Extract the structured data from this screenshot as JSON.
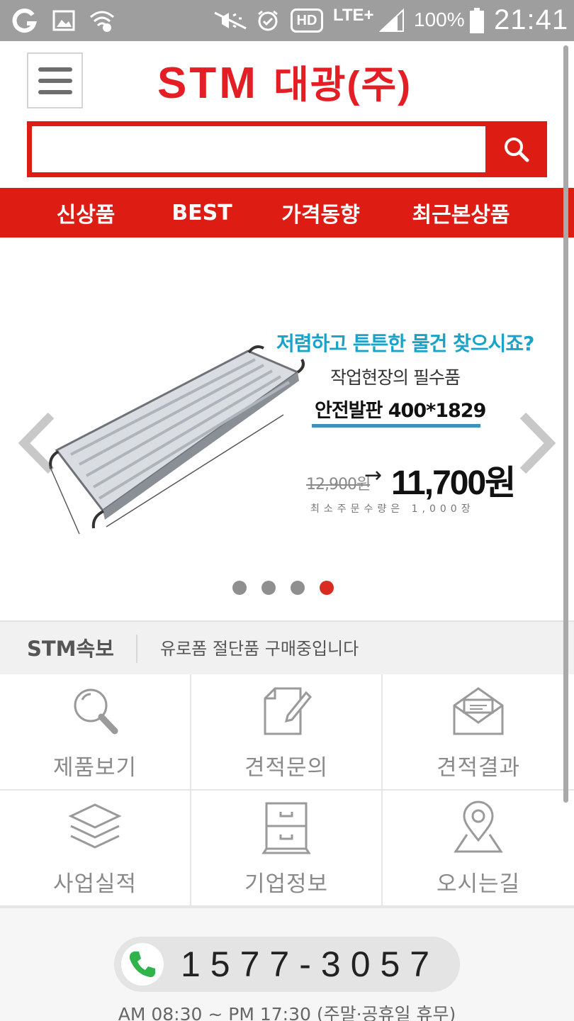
{
  "status_bar": {
    "battery": "100%",
    "time": "21:41",
    "network": "LTE+",
    "hd": "HD"
  },
  "header": {
    "logo": "STM",
    "logo_kor": "대광(주)",
    "search": {
      "placeholder": ""
    }
  },
  "nav": {
    "items": [
      "신상품",
      "BEST",
      "가격동향",
      "최근본상품"
    ]
  },
  "banner": {
    "headline": "저렴하고 튼튼한 물건 찾으시죠?",
    "sub": "작업현장의 필수품",
    "product": "안전발판 400*1829",
    "old_price": "12,900원",
    "arrow": "→",
    "new_price": "11,700원",
    "min_order": "최소주문수량은 1,000장",
    "slides_total": 4,
    "active_slide": 4,
    "accent": "#1aa3c9"
  },
  "news": {
    "title": "STM속보",
    "text": "유로폼 절단품 구매중입니다"
  },
  "menu_grid": [
    {
      "label": "제품보기",
      "icon": "search-icon"
    },
    {
      "label": "견적문의",
      "icon": "document-edit-icon"
    },
    {
      "label": "견적결과",
      "icon": "envelope-open-icon"
    },
    {
      "label": "사업실적",
      "icon": "layers-icon"
    },
    {
      "label": "기업정보",
      "icon": "cabinet-icon"
    },
    {
      "label": "오시는길",
      "icon": "map-pin-icon"
    }
  ],
  "footer": {
    "phone": "1577-3057",
    "hours": "AM 08:30 ~ PM 17:30 (주말·공휴일 휴무)"
  },
  "colors": {
    "brand_red": "#dd1c14",
    "status_bar": "#9e9e9e",
    "phone_green": "#2fb34a"
  }
}
